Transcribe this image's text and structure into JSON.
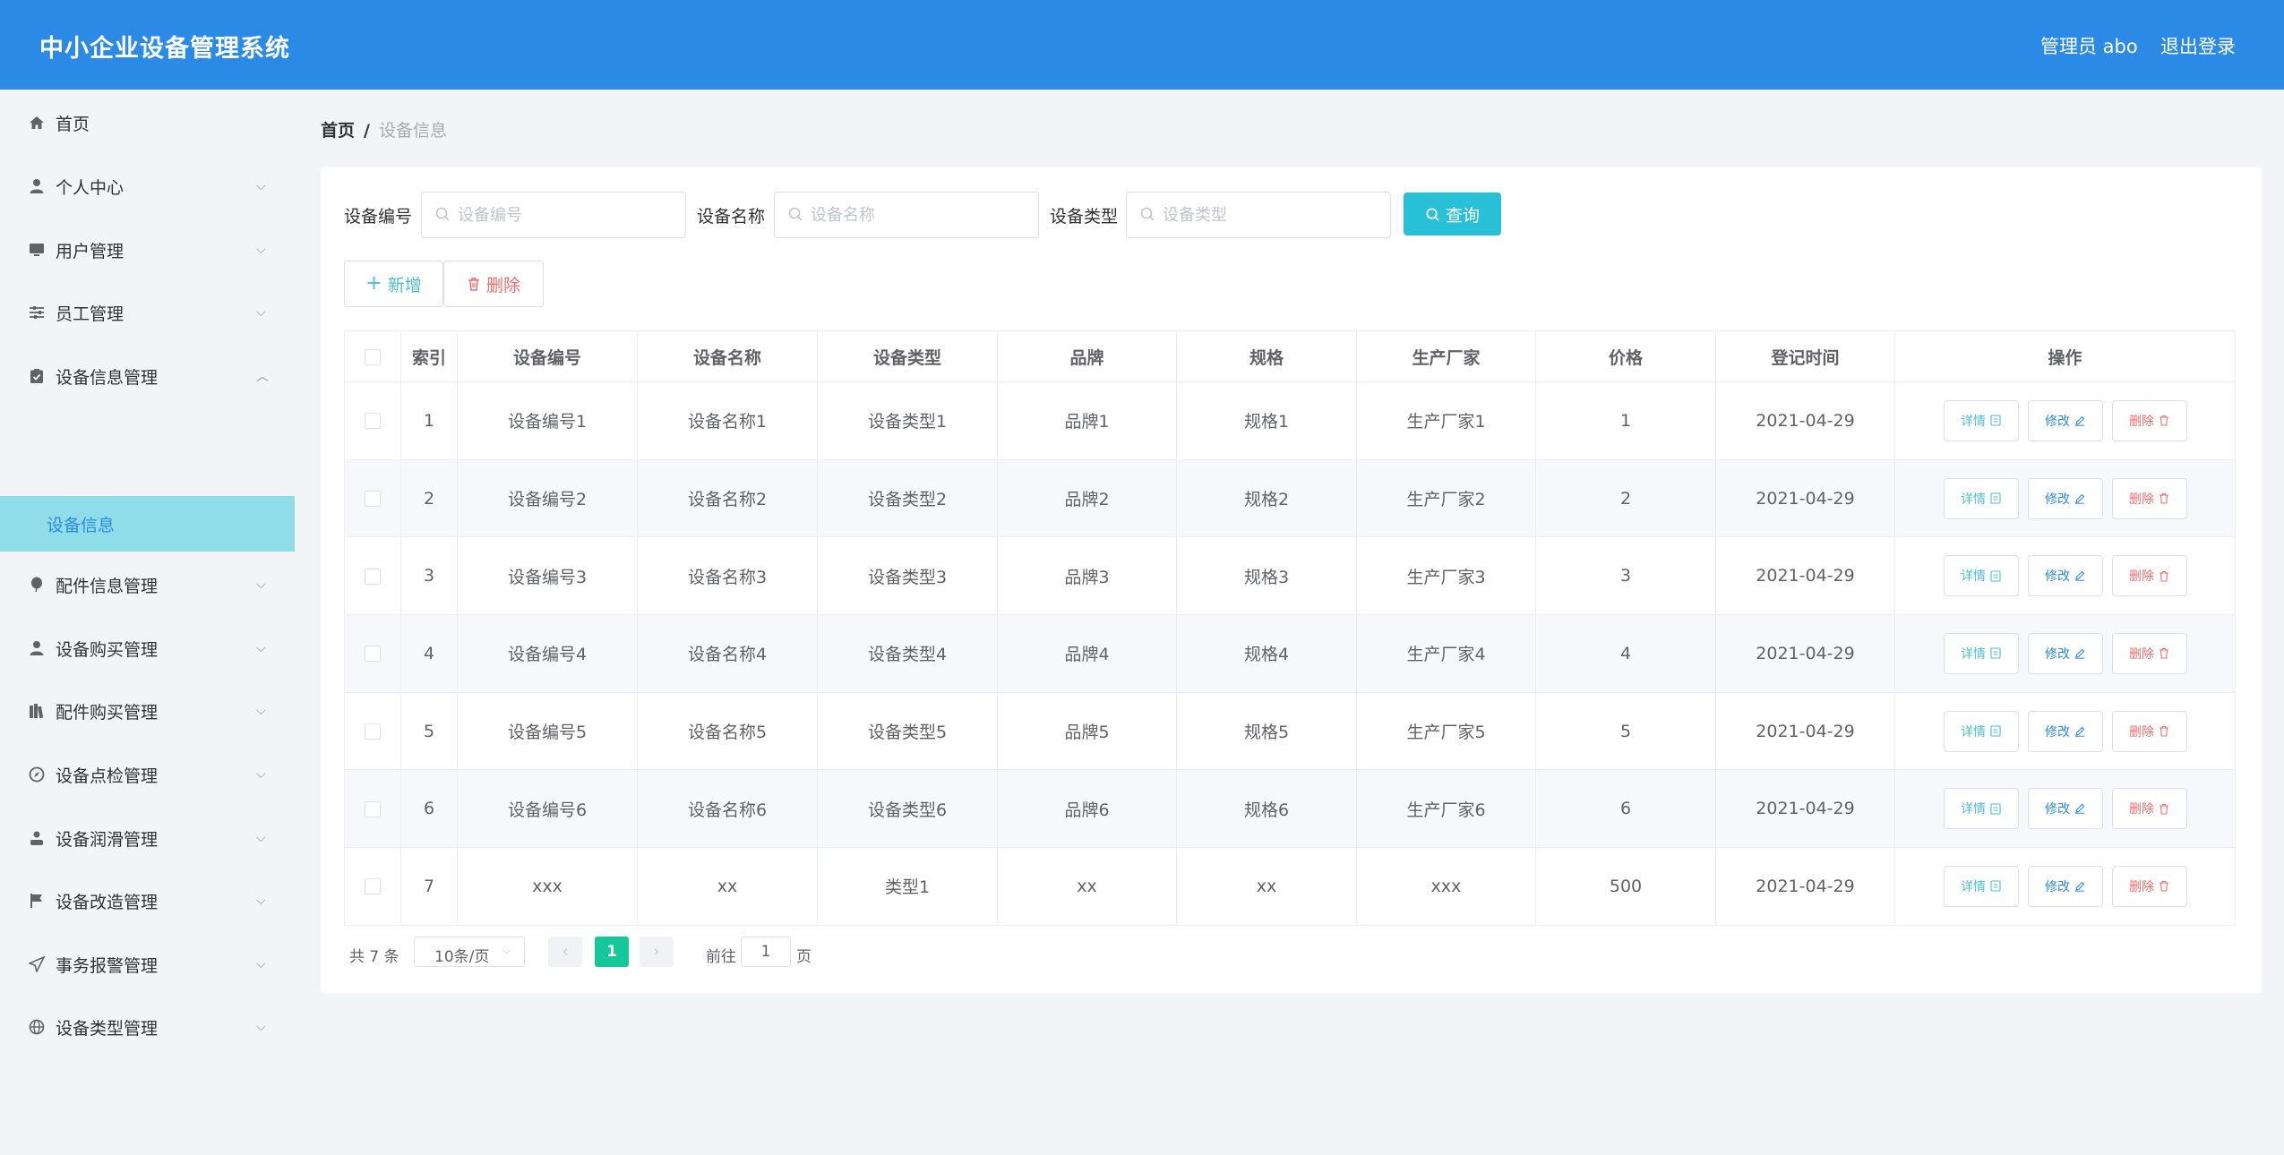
{
  "header": {
    "title": "中小企业设备管理系统",
    "user": "管理员 abo",
    "logout": "退出登录"
  },
  "sidebar": {
    "items": [
      {
        "label": "首页",
        "icon": "home-icon"
      },
      {
        "label": "个人中心",
        "icon": "user-icon"
      },
      {
        "label": "用户管理",
        "icon": "monitor-icon"
      },
      {
        "label": "员工管理",
        "icon": "sliders-icon"
      },
      {
        "label": "设备信息管理",
        "icon": "clipboard-icon"
      },
      {
        "label": "配件信息管理",
        "icon": "balloon-icon"
      },
      {
        "label": "设备购买管理",
        "icon": "avatar-icon"
      },
      {
        "label": "配件购买管理",
        "icon": "books-icon"
      },
      {
        "label": "设备点检管理",
        "icon": "compass-icon"
      },
      {
        "label": "设备润滑管理",
        "icon": "person-icon"
      },
      {
        "label": "设备改造管理",
        "icon": "flag-icon"
      },
      {
        "label": "事务报警管理",
        "icon": "send-icon"
      },
      {
        "label": "设备类型管理",
        "icon": "globe-icon"
      }
    ],
    "active_sub": "设备信息"
  },
  "breadcrumb": {
    "home": "首页",
    "separator": "/",
    "current": "设备信息"
  },
  "search": {
    "code_label": "设备编号",
    "code_placeholder": "设备编号",
    "name_label": "设备名称",
    "name_placeholder": "设备名称",
    "type_label": "设备类型",
    "type_placeholder": "设备类型",
    "query": "查询"
  },
  "actions": {
    "add": "新增",
    "delete": "删除"
  },
  "table": {
    "columns": [
      "索引",
      "设备编号",
      "设备名称",
      "设备类型",
      "品牌",
      "规格",
      "生产厂家",
      "价格",
      "登记时间",
      "操作"
    ],
    "rows": [
      [
        "1",
        "设备编号1",
        "设备名称1",
        "设备类型1",
        "品牌1",
        "规格1",
        "生产厂家1",
        "1",
        "2021-04-29"
      ],
      [
        "2",
        "设备编号2",
        "设备名称2",
        "设备类型2",
        "品牌2",
        "规格2",
        "生产厂家2",
        "2",
        "2021-04-29"
      ],
      [
        "3",
        "设备编号3",
        "设备名称3",
        "设备类型3",
        "品牌3",
        "规格3",
        "生产厂家3",
        "3",
        "2021-04-29"
      ],
      [
        "4",
        "设备编号4",
        "设备名称4",
        "设备类型4",
        "品牌4",
        "规格4",
        "生产厂家4",
        "4",
        "2021-04-29"
      ],
      [
        "5",
        "设备编号5",
        "设备名称5",
        "设备类型5",
        "品牌5",
        "规格5",
        "生产厂家5",
        "5",
        "2021-04-29"
      ],
      [
        "6",
        "设备编号6",
        "设备名称6",
        "设备类型6",
        "品牌6",
        "规格6",
        "生产厂家6",
        "6",
        "2021-04-29"
      ],
      [
        "7",
        "xxx",
        "xx",
        "类型1",
        "xx",
        "xx",
        "xxx",
        "500",
        "2021-04-29"
      ]
    ],
    "row_actions": {
      "detail": "详情",
      "edit": "修改",
      "remove": "删除"
    }
  },
  "pagination": {
    "total": "共 7 条",
    "page_size": "10条/页",
    "current_page": "1",
    "goto_label": "前往",
    "goto_value": "1",
    "page_suffix": "页"
  },
  "colors": {
    "header": "#2b8ae6",
    "query": "#27c0d6",
    "active_sub_bg": "#8fdde9",
    "pager_active": "#16c79a",
    "danger": "#f56c6c"
  }
}
